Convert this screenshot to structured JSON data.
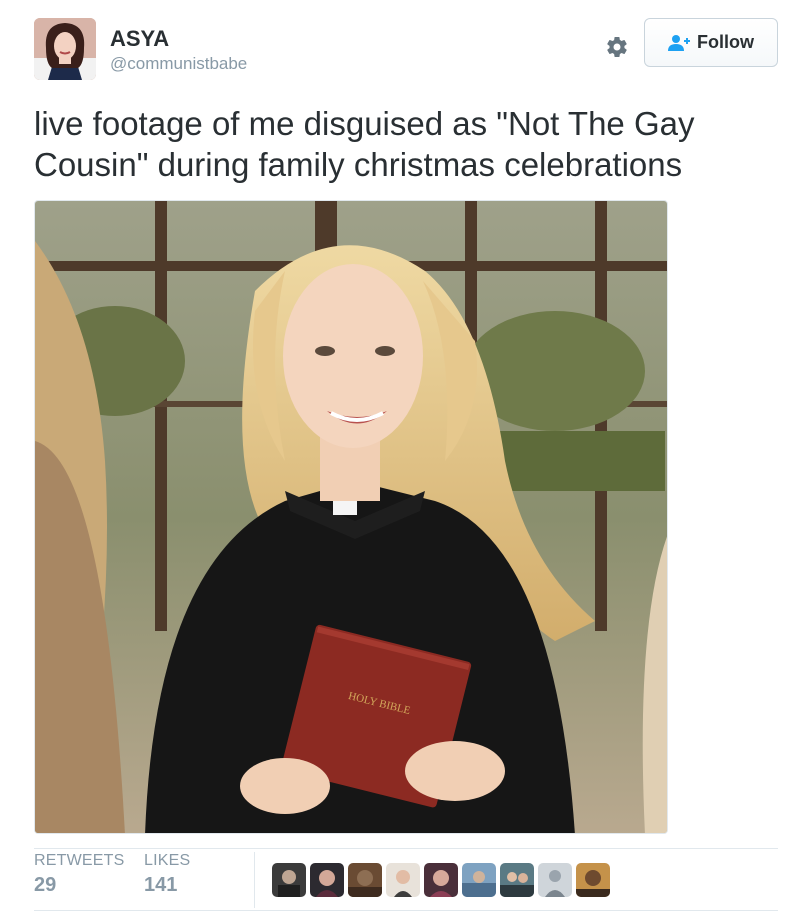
{
  "user": {
    "name": "ASYA",
    "handle": "@communistbabe"
  },
  "actions": {
    "follow_label": "Follow",
    "settings_icon": "gear-icon",
    "follow_icon": "person-plus-icon"
  },
  "tweet": {
    "text": "live footage of me disguised as \"Not The Gay Cousin\" during family christmas celebrations"
  },
  "media": {
    "book_cover_text": "HOLY BIBLE"
  },
  "stats": {
    "retweets_label": "RETWEETS",
    "retweets_count": "29",
    "likes_label": "LIKES",
    "likes_count": "141"
  },
  "likers_count_shown": 9,
  "colors": {
    "text": "#292f33",
    "muted": "#8899a6",
    "accent": "#1da1f2",
    "border": "#e1e8ed"
  }
}
